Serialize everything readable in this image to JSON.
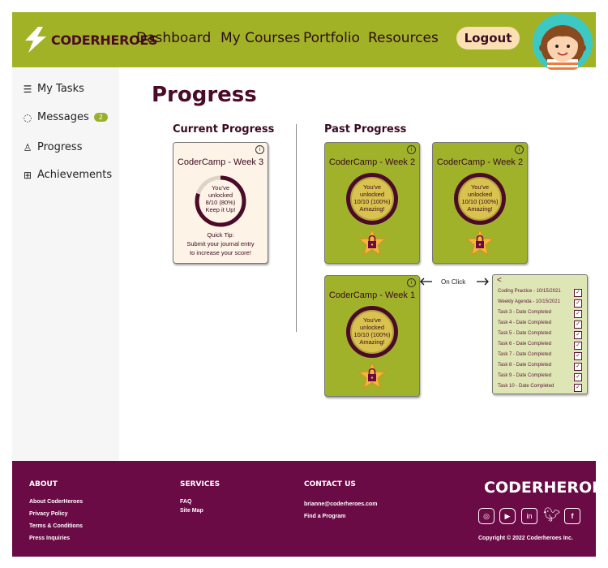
{
  "header": {
    "logo_text": "CODERHEROES",
    "nav": [
      "Dashboard",
      "My Courses",
      "Portfolio",
      "Resources"
    ],
    "logout_label": "Logout"
  },
  "sidebar": {
    "items": [
      {
        "label": "My Tasks",
        "icon": "list-icon"
      },
      {
        "label": "Messages",
        "icon": "chat-icon",
        "badge": "2"
      },
      {
        "label": "Progress",
        "icon": "person-icon"
      },
      {
        "label": "Achievements",
        "icon": "gift-icon"
      }
    ]
  },
  "main": {
    "title": "Progress",
    "current_title": "Current Progress",
    "past_title": "Past Progress",
    "current_card": {
      "title": "CoderCamp - Week 3",
      "ring_lines": [
        "You've",
        "unlocked",
        "8/10 (80%)",
        "Keep it Up!"
      ],
      "tip_lines": [
        "Quick Tip:",
        "Submit your journal entry",
        "to increase your score!"
      ],
      "progress": 0.8
    },
    "past_cards": [
      {
        "title": "CoderCamp - Week 2",
        "ring_lines": [
          "You've",
          "unlocked",
          "10/10 (100%)",
          "Amazing!"
        ]
      },
      {
        "title": "CoderCamp - Week 2",
        "ring_lines": [
          "You've",
          "unlocked",
          "10/10 (100%)",
          "Amazing!"
        ]
      },
      {
        "title": "CoderCamp - Week 1",
        "ring_lines": [
          "You've",
          "unlocked",
          "10/10 (100%)",
          "Amazing!"
        ]
      }
    ],
    "on_click_label": "On Click",
    "popup": {
      "back": "<",
      "tasks": [
        "Coding Practice - 10/15/2021",
        "Weekly Agenda - 10/15/2021",
        "Task 3 - Date Completed",
        "Task 4 - Date Completed",
        "Task 5 - Date Completed",
        "Task 6 - Date Completed",
        "Task 7 - Date Completed",
        "Task 8 - Date Completed",
        "Task 9 - Date Completed",
        "Task 10 - Date Completed"
      ]
    }
  },
  "footer": {
    "about": {
      "heading": "ABOUT",
      "links": [
        "About CoderHeroes",
        "Privacy Policy",
        "Terms & Conditions",
        "Press Inquiries"
      ]
    },
    "services": {
      "heading": "SERVICES",
      "links": [
        "FAQ",
        "Site Map"
      ]
    },
    "contact": {
      "heading": "CONTACT US",
      "links": [
        "brianne@coderheroes.com",
        "Find a Program"
      ]
    },
    "brand": "CODERHEROES",
    "copyright": "Copyright © 2022 Coderheroes Inc.",
    "social_icons": [
      "instagram-icon",
      "youtube-icon",
      "linkedin-icon",
      "twitter-icon",
      "facebook-icon"
    ]
  },
  "colors": {
    "accent_green": "#a2b226",
    "brand_maroon": "#6a0b46",
    "star": "#f4b63c"
  }
}
